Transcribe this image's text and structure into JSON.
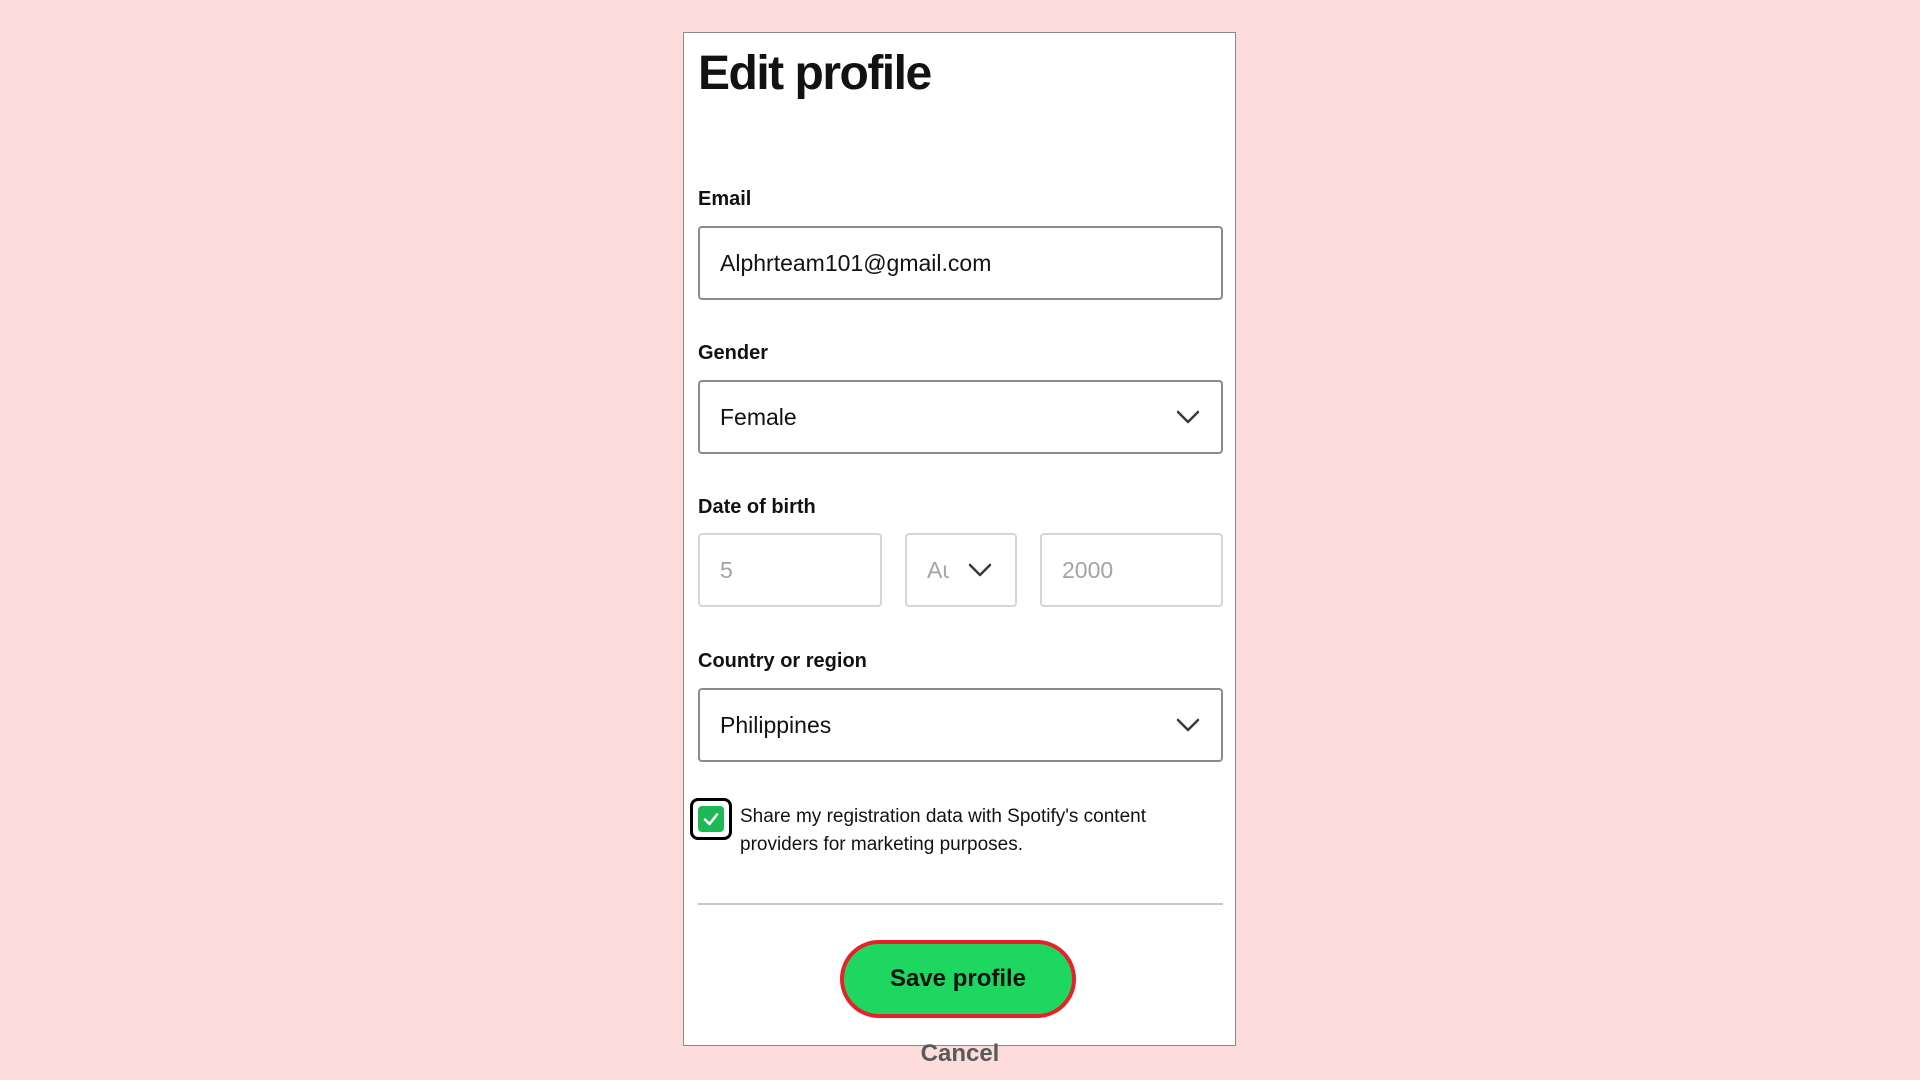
{
  "page": {
    "title": "Edit profile"
  },
  "email": {
    "label": "Email",
    "value": "Alphrteam101@gmail.com"
  },
  "gender": {
    "label": "Gender",
    "value": "Female"
  },
  "date_of_birth": {
    "label": "Date of birth",
    "day": "5",
    "month": "Au",
    "year": "2000"
  },
  "country": {
    "label": "Country or region",
    "value": "Philippines"
  },
  "consent": {
    "checked": true,
    "text": "Share my registration data with Spotify's content providers for marketing purposes."
  },
  "actions": {
    "save_label": "Save profile",
    "cancel_label": "Cancel"
  },
  "colors": {
    "background": "#fddddb",
    "accent_green": "#1ed760",
    "checkbox_green": "#1db954",
    "highlight_red": "#e8202a"
  },
  "icons": {
    "dropdown": "chevron-down-icon",
    "checkbox": "checkmark-icon"
  }
}
